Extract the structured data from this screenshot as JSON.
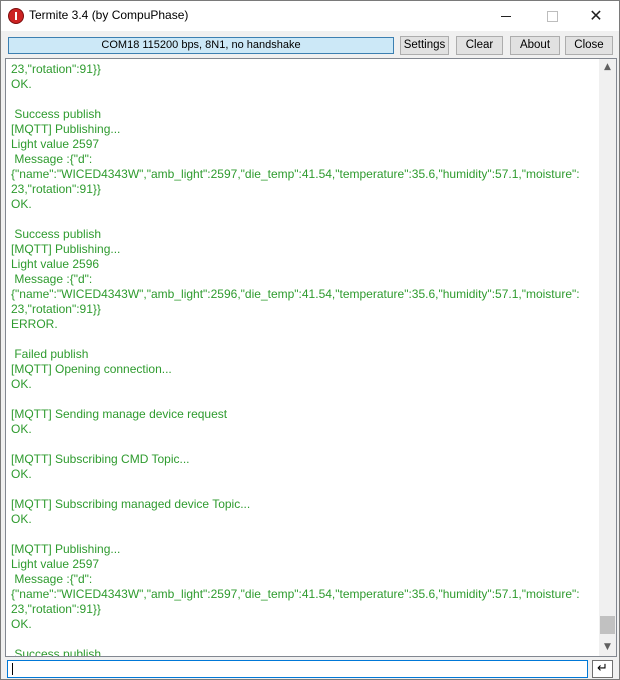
{
  "window": {
    "title": "Termite 3.4 (by CompuPhase)",
    "controls": {
      "minimize": "—",
      "maximize": "□",
      "close": "✕"
    }
  },
  "toolbar": {
    "status": "COM18 115200 bps, 8N1, no handshake",
    "settings_label": "Settings",
    "clear_label": "Clear",
    "about_label": "About",
    "close_label": "Close"
  },
  "terminal": {
    "lines": [
      "23,\"rotation\":91}}",
      "OK.",
      "",
      " Success publish",
      "[MQTT] Publishing...",
      "Light value 2597",
      " Message :{\"d\":",
      "{\"name\":\"WICED4343W\",\"amb_light\":2597,\"die_temp\":41.54,\"temperature\":35.6,\"humidity\":57.1,\"moisture\":",
      "23,\"rotation\":91}}",
      "OK.",
      "",
      " Success publish",
      "[MQTT] Publishing...",
      "Light value 2596",
      " Message :{\"d\":",
      "{\"name\":\"WICED4343W\",\"amb_light\":2596,\"die_temp\":41.54,\"temperature\":35.6,\"humidity\":57.1,\"moisture\":",
      "23,\"rotation\":91}}",
      "ERROR.",
      "",
      " Failed publish",
      "[MQTT] Opening connection...",
      "OK.",
      "",
      "[MQTT] Sending manage device request",
      "OK.",
      "",
      "[MQTT] Subscribing CMD Topic...",
      "OK.",
      "",
      "[MQTT] Subscribing managed device Topic...",
      "OK.",
      "",
      "[MQTT] Publishing...",
      "Light value 2597",
      " Message :{\"d\":",
      "{\"name\":\"WICED4343W\",\"amb_light\":2597,\"die_temp\":41.54,\"temperature\":35.6,\"humidity\":57.1,\"moisture\":",
      "23,\"rotation\":91}}",
      "OK.",
      "",
      " Success publish"
    ],
    "text_color": "#2e9b2e"
  },
  "input": {
    "value": ""
  },
  "send_button": {
    "icon": "enter-arrow-icon",
    "glyph": "↵"
  },
  "scrollbar": {
    "up_glyph": "▲",
    "down_glyph": "▼"
  }
}
